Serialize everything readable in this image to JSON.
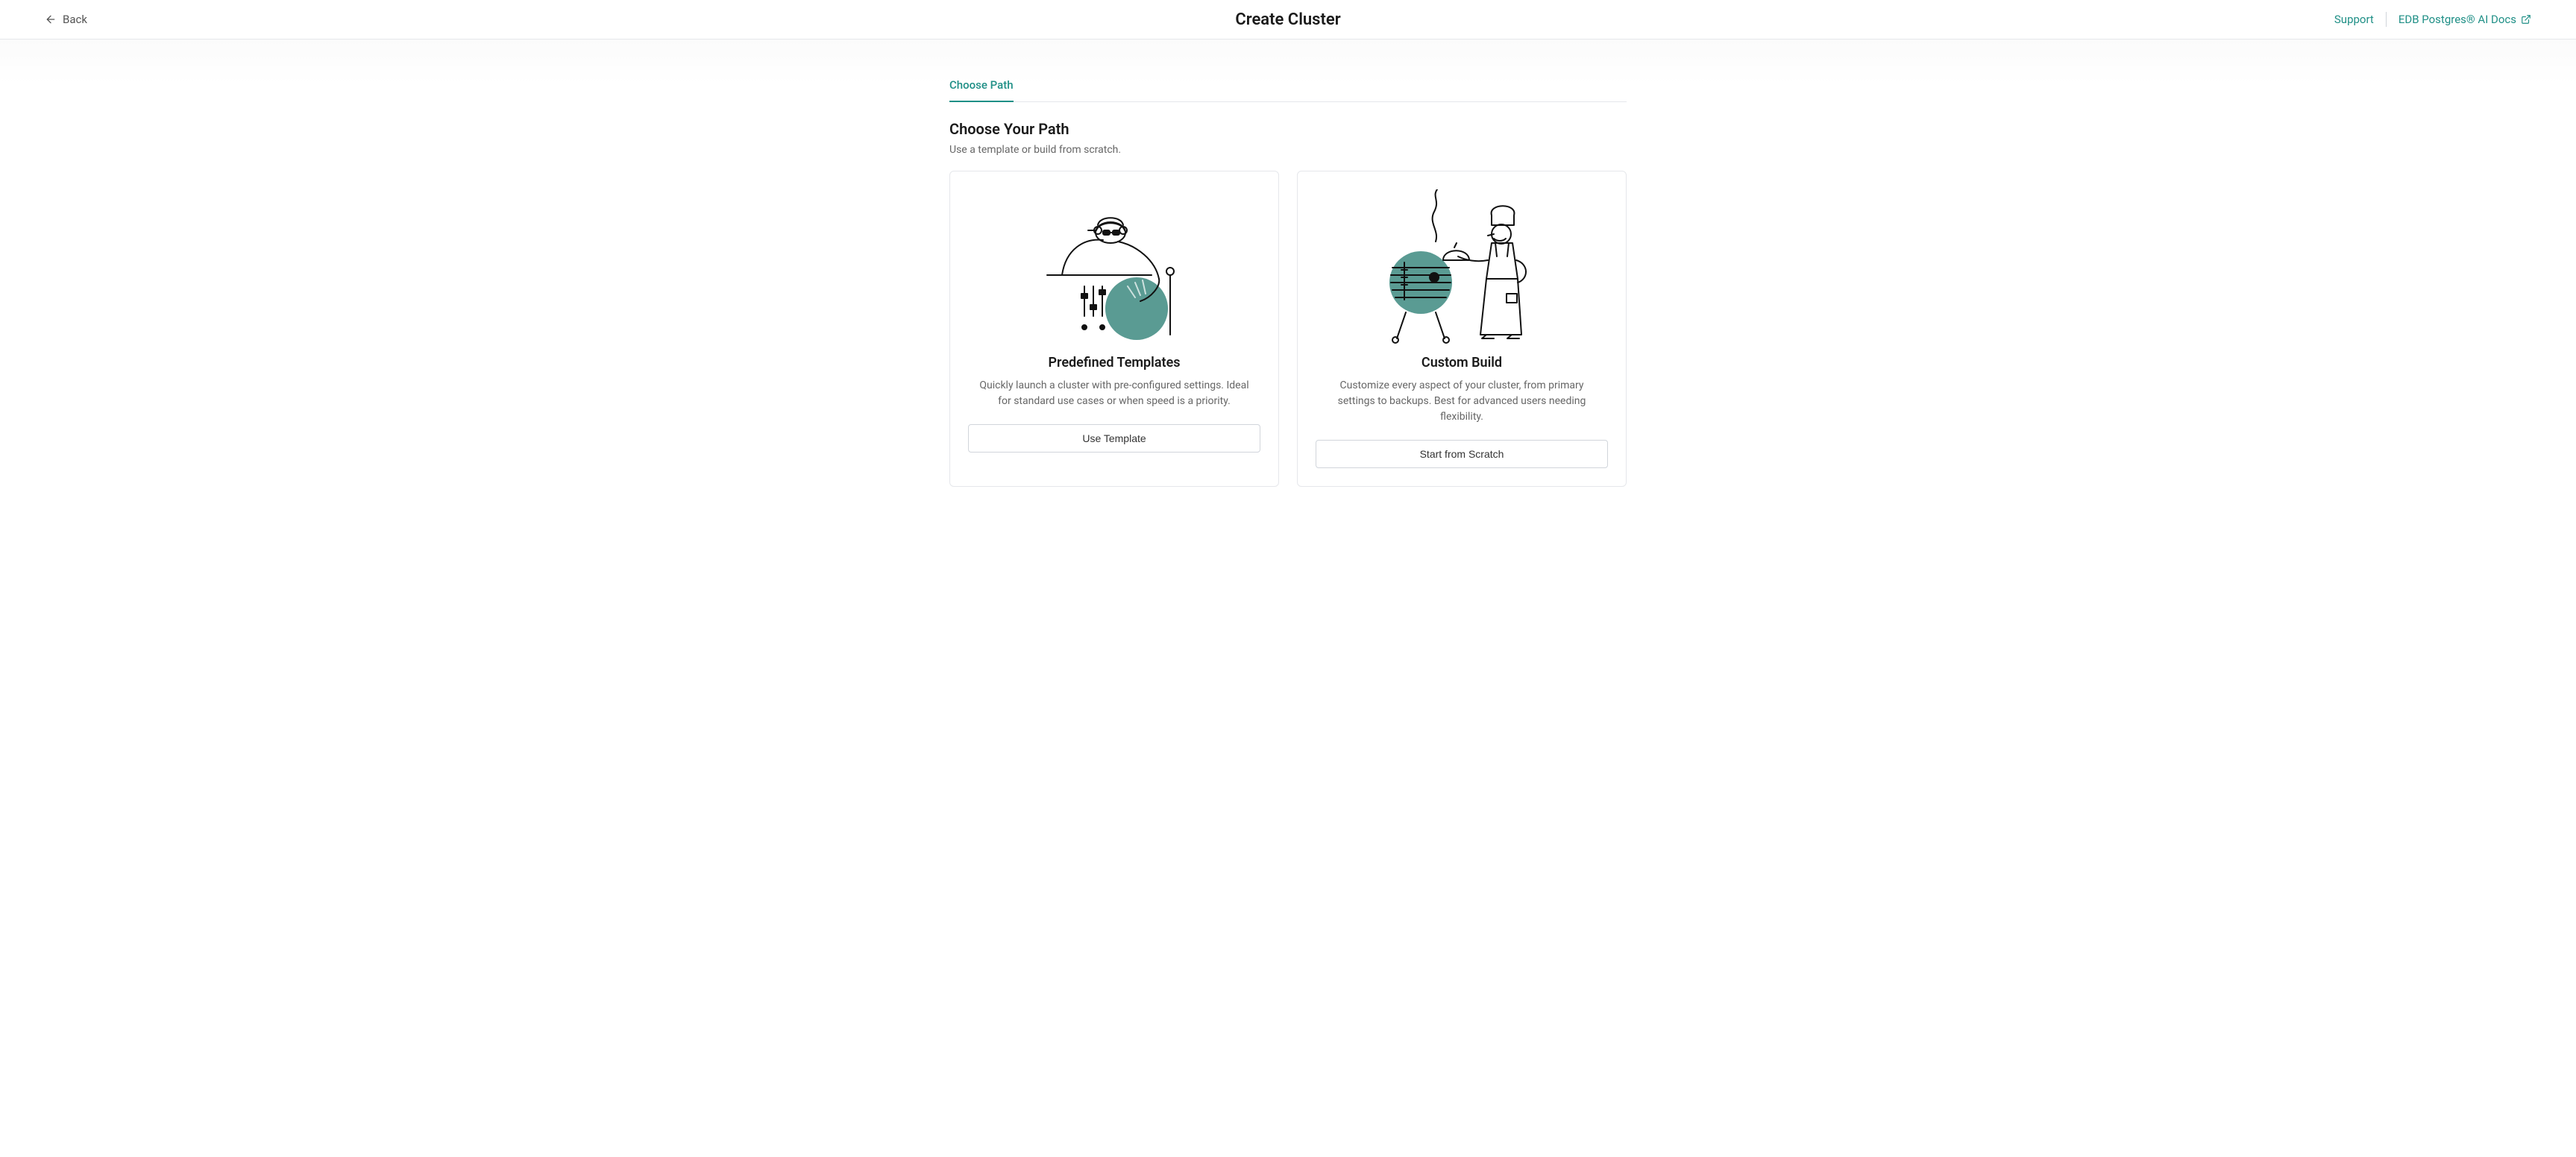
{
  "header": {
    "back_label": "Back",
    "title": "Create Cluster",
    "support_label": "Support",
    "docs_label": "EDB Postgres® AI Docs"
  },
  "tabs": {
    "choose_path": "Choose Path"
  },
  "main": {
    "heading": "Choose Your Path",
    "subheading": "Use a template or build from scratch."
  },
  "cards": {
    "template": {
      "title": "Predefined Templates",
      "description": "Quickly launch a cluster with pre-configured settings. Ideal for standard use cases or when speed is a priority.",
      "button": "Use Template"
    },
    "custom": {
      "title": "Custom Build",
      "description": "Customize every aspect of your cluster, from primary settings to backups. Best for advanced users needing flexibility.",
      "button": "Start from Scratch"
    }
  }
}
